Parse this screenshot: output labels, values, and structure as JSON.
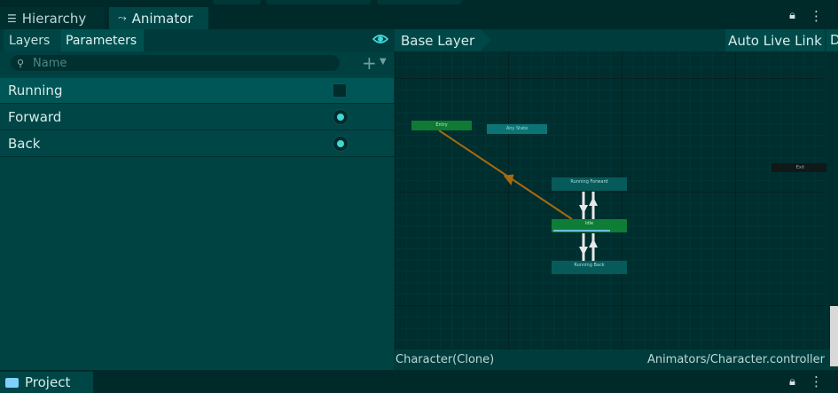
{
  "window_tabs": [
    {
      "label": "Hierarchy",
      "icon": "list-icon"
    },
    {
      "label": "Animator",
      "icon": "animator-icon"
    }
  ],
  "animator": {
    "left_tabs": [
      "Layers",
      "Parameters"
    ],
    "search": {
      "placeholder": "Name",
      "value": ""
    },
    "parameters": [
      {
        "name": "Running",
        "type": "bool",
        "value": false
      },
      {
        "name": "Forward",
        "type": "trigger"
      },
      {
        "name": "Back",
        "type": "trigger"
      }
    ],
    "breadcrumb": "Base Layer",
    "auto_live_link": "Auto Live Link",
    "edge_button_char": "D",
    "graph": {
      "states": {
        "entry": "Entry",
        "any_state": "Any State",
        "exit": "Exit",
        "running_forward": "Running Forward",
        "idle": "Idle",
        "running_back": "Running Back"
      },
      "idle_progress": 0.79
    },
    "status": {
      "object": "Character(Clone)",
      "controller": "Animators/Character.controller"
    }
  },
  "bottom_tabs": [
    {
      "label": "Project",
      "icon": "folder-icon"
    }
  ],
  "colors": {
    "entry_state": "#0e7a33",
    "default_state": "#0e7d36",
    "state": "#075a5a",
    "any_state": "#0c7474",
    "transition_default": "#a86a10",
    "transition": "#e8e8e8",
    "accent": "#3fd6d6"
  }
}
